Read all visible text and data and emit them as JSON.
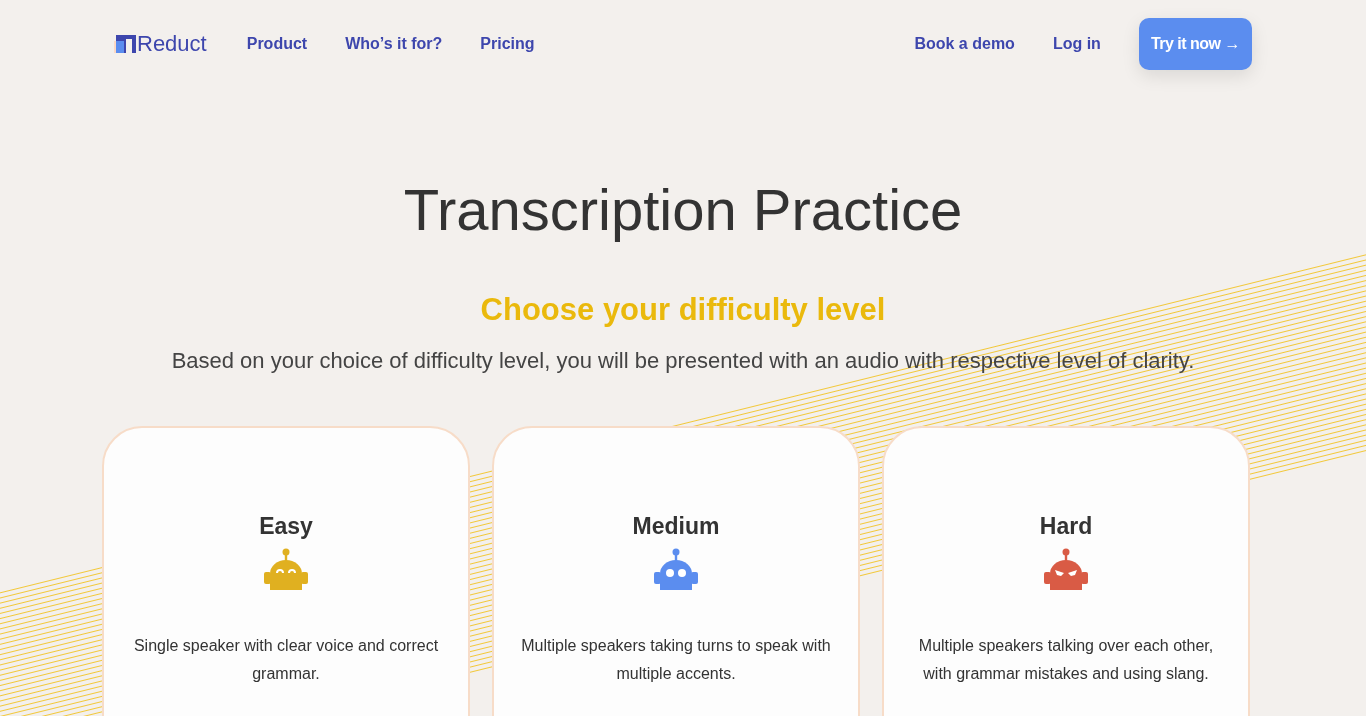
{
  "nav": {
    "logo": "Reduct",
    "links": [
      "Product",
      "Who’s it for?",
      "Pricing"
    ],
    "right_links": [
      "Book a demo",
      "Log in"
    ],
    "cta": "Try it now →"
  },
  "hero": {
    "title": "Transcription Practice",
    "subtitle": "Choose your difficulty level",
    "description": "Based on your choice of difficulty level, you will be presented with an audio with respective level of clarity."
  },
  "cards": [
    {
      "title": "Easy",
      "kind": "happy",
      "color": "#e0b020",
      "text": "Single speaker with clear voice and correct grammar."
    },
    {
      "title": "Medium",
      "kind": "neutral",
      "color": "#5b8def",
      "text": "Multiple speakers taking turns to speak with multiple accents."
    },
    {
      "title": "Hard",
      "kind": "angry",
      "color": "#d95b45",
      "text": "Multiple speakers talking over each other, with grammar mistakes and using slang."
    }
  ]
}
